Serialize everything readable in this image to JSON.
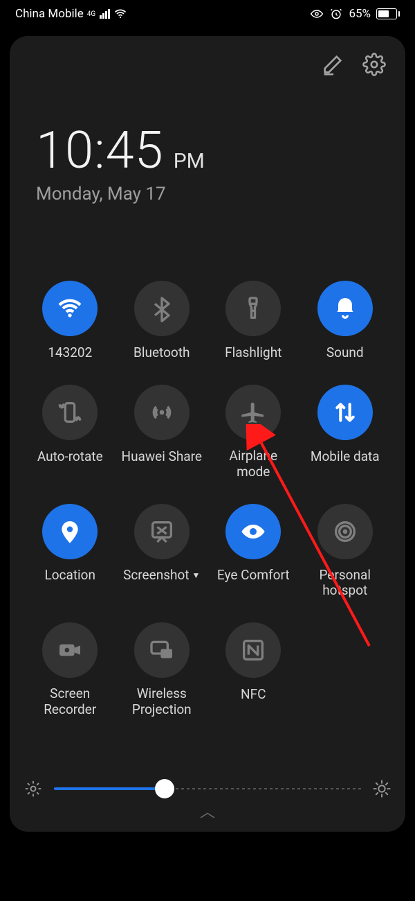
{
  "status": {
    "carrier": "China Mobile",
    "network_badge": "4G",
    "battery_text": "65%"
  },
  "clock": {
    "time": "10:45",
    "ampm": "PM",
    "date": "Monday, May 17"
  },
  "tiles": [
    {
      "id": "wifi",
      "label": "143202",
      "active": true
    },
    {
      "id": "bluetooth",
      "label": "Bluetooth",
      "active": false
    },
    {
      "id": "flashlight",
      "label": "Flashlight",
      "active": false
    },
    {
      "id": "sound",
      "label": "Sound",
      "active": true
    },
    {
      "id": "auto-rotate",
      "label": "Auto-rotate",
      "active": false
    },
    {
      "id": "huawei-share",
      "label": "Huawei Share",
      "active": false
    },
    {
      "id": "airplane-mode",
      "label": "Airplane\nmode",
      "active": false
    },
    {
      "id": "mobile-data",
      "label": "Mobile data",
      "active": true
    },
    {
      "id": "location",
      "label": "Location",
      "active": true
    },
    {
      "id": "screenshot",
      "label": "Screenshot",
      "active": false,
      "dropdown": true
    },
    {
      "id": "eye-comfort",
      "label": "Eye Comfort",
      "active": true
    },
    {
      "id": "personal-hotspot",
      "label": "Personal\nhotspot",
      "active": false
    },
    {
      "id": "screen-recorder",
      "label": "Screen\nRecorder",
      "active": false
    },
    {
      "id": "wireless-proj",
      "label": "Wireless\nProjection",
      "active": false
    },
    {
      "id": "nfc",
      "label": "NFC",
      "active": false
    }
  ],
  "brightness": {
    "percent": 36
  },
  "colors": {
    "accent": "#1e73e8"
  }
}
